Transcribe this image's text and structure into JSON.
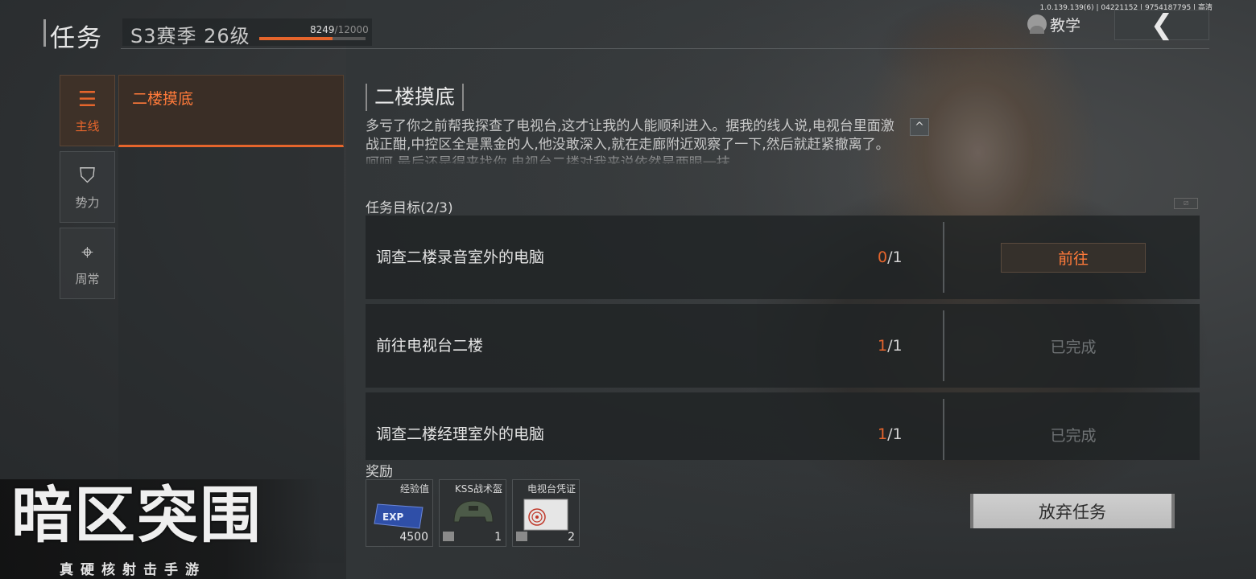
{
  "header": {
    "title": "任务",
    "season_label": "S3赛季 26级",
    "xp_current": "8249",
    "xp_max": "/12000",
    "xp_progress_fraction": 0.687,
    "version_info": "1.0.139.139(6) | 04221152 | 9754187795 | 高清",
    "tutorial_label": "教学",
    "back_symbol": "❮"
  },
  "nav": {
    "items": [
      {
        "label": "主线",
        "icon": "list-icon",
        "glyph": "☰",
        "active": true
      },
      {
        "label": "势力",
        "icon": "faction-icon",
        "glyph": "⛉",
        "active": false
      },
      {
        "label": "周常",
        "icon": "crosshair-icon",
        "glyph": "⌖",
        "active": false
      }
    ]
  },
  "task_list": [
    {
      "name": "二楼摸底",
      "selected": true
    }
  ],
  "detail": {
    "title": "二楼摸底",
    "description": "多亏了你之前帮我探查了电视台,这才让我的人能顺利进入。据我的线人说,电视台里面激战正酣,中控区全是黑金的人,他没敢深入,就在走廊附近观察了一下,然后就赶紧撤离了。呵呵,最后还是得来找你,电视台二楼对我来说依然是两眼一抹",
    "collapse_symbol": "^",
    "objectives_header": "任务目标(2/3)",
    "objectives": [
      {
        "name": "调查二楼录音室外的电脑",
        "current": "0",
        "total": "/1",
        "action": "前往",
        "completed": false
      },
      {
        "name": "前往电视台二楼",
        "current": "1",
        "total": "/1",
        "action": "已完成",
        "completed": true
      },
      {
        "name": "调查二楼经理室外的电脑",
        "current": "1",
        "total": "/1",
        "action": "已完成",
        "completed": true
      }
    ],
    "rewards_header": "奖励",
    "rewards": [
      {
        "name": "经验值",
        "qty": "4500",
        "art": "exp-card",
        "art_text": "EXP"
      },
      {
        "name": "KSS战术盔",
        "qty": "1",
        "art": "helmet"
      },
      {
        "name": "电视台凭证",
        "qty": "2",
        "art": "fingerprint-card"
      }
    ],
    "abandon_label": "放弃任务"
  },
  "branding": {
    "logo": "暗区突围",
    "subtitle": "真硬核射击手游"
  },
  "colors": {
    "accent": "#e5652c",
    "background": "#33373a",
    "muted": "#6e7274"
  }
}
